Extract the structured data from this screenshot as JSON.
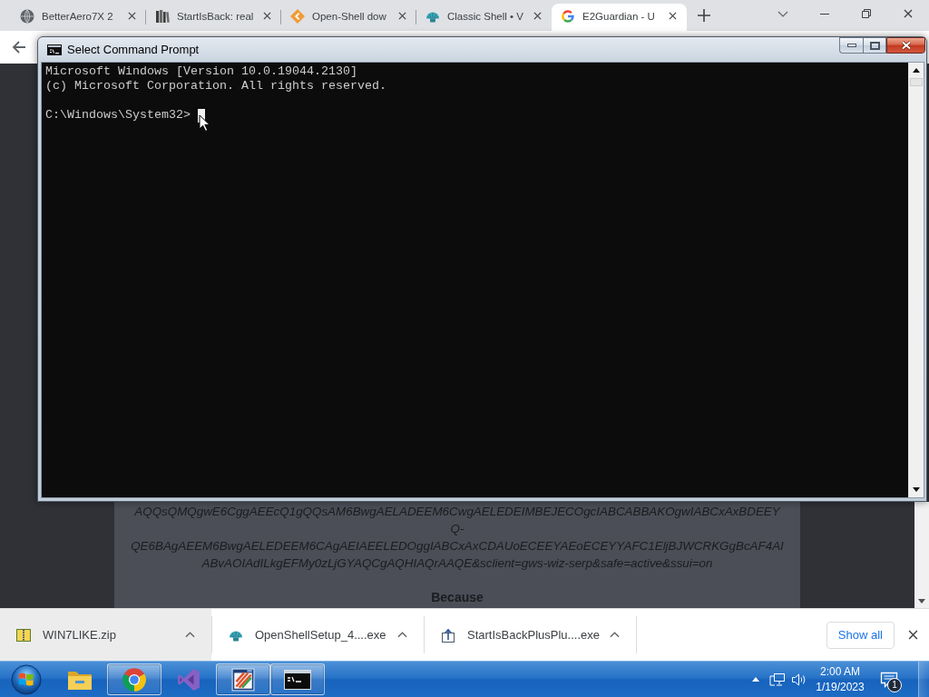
{
  "browser": {
    "tabs": [
      {
        "title": "BetterAero7X 2",
        "kind": "globe",
        "selected": false
      },
      {
        "title": "StartIsBack: real",
        "kind": "books",
        "selected": false
      },
      {
        "title": "Open-Shell dow",
        "kind": "diamond",
        "selected": false
      },
      {
        "title": "Classic Shell • V",
        "kind": "shell",
        "selected": false
      },
      {
        "title": "E2Guardian - U",
        "kind": "g",
        "selected": true
      }
    ]
  },
  "page": {
    "url_lines": [
      "AQQsQMQgwE6CggAEEcQ1gQQsAM6BwgAELADEEM6CwgAELEDEIMBEJECOgcIABCABBAKOgwIABCxAxBDEEY",
      "Q-",
      "QE6BAgAEEM6BwgAELEDEEM6CAgAEIAEELEDOggIABCxAxCDAUoECEEYAEoECEYYAFC1EljBJWCRKGgBcAF4AI",
      "ABvAOIAdILkgEFMy0zLjGYAQCgAQHIAQrAAQE&sclient=gws-wiz-serp&safe=active&ssui=on"
    ],
    "heading": "Because"
  },
  "console": {
    "title": "Select Command Prompt",
    "lines": [
      "Microsoft Windows [Version 10.0.19044.2130]",
      "(c) Microsoft Corporation. All rights reserved."
    ],
    "prompt": "C:\\Windows\\System32>"
  },
  "downloads": {
    "items": [
      {
        "name": "WIN7LIKE.zip",
        "kind": "archive",
        "hovered": true
      },
      {
        "name": "OpenShellSetup_4....exe",
        "kind": "shell",
        "hovered": false
      },
      {
        "name": "StartIsBackPlusPlu....exe",
        "kind": "installer",
        "hovered": false
      }
    ],
    "show_all": "Show all"
  },
  "taskbar": {
    "items": [
      {
        "kind": "folder",
        "running": false
      },
      {
        "kind": "browser",
        "running": true
      },
      {
        "kind": "studio",
        "running": false
      },
      {
        "kind": "paint",
        "running": true
      },
      {
        "kind": "terminal",
        "running": true
      }
    ],
    "clock": {
      "time": "2:00 AM",
      "date": "1/19/2023"
    },
    "notification_count": "1"
  }
}
